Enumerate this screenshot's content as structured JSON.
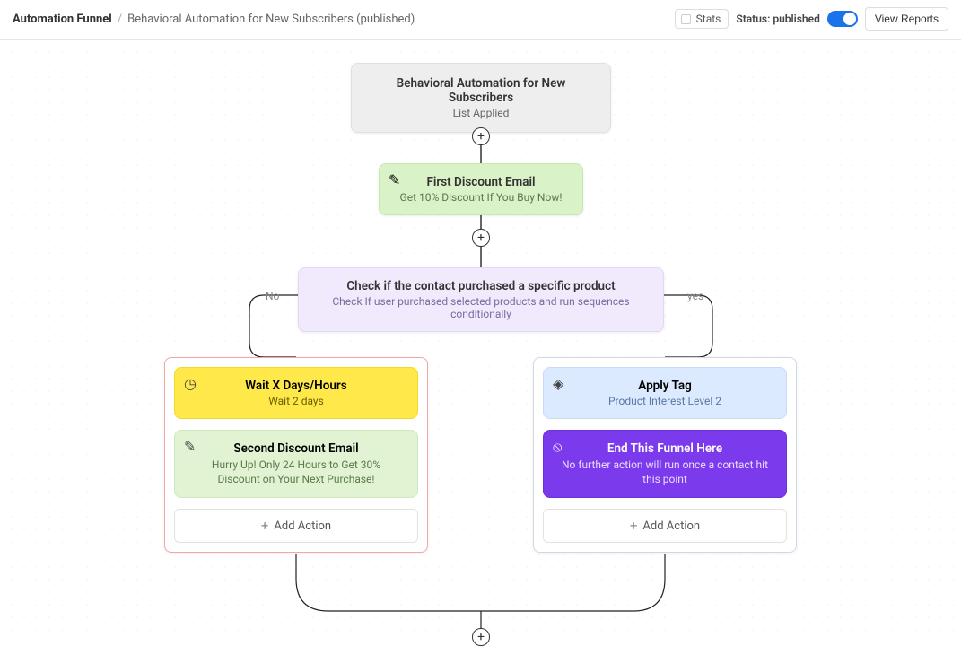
{
  "header": {
    "breadcrumb_root": "Automation Funnel",
    "breadcrumb_sep": "/",
    "breadcrumb_current": "Behavioral Automation for New Subscribers (published)",
    "stats_label": "Stats",
    "status_label": "Status: published",
    "view_reports": "View Reports"
  },
  "trigger": {
    "title": "Behavioral Automation for New Subscribers",
    "subtitle": "List Applied"
  },
  "email1": {
    "title": "First Discount Email",
    "subtitle": "Get 10% Discount If You Buy Now!"
  },
  "condition": {
    "title": "Check if the contact purchased a specific product",
    "subtitle": "Check If user purchased selected products and run sequences conditionally",
    "no_label": "No",
    "yes_label": "yes"
  },
  "no_branch": {
    "wait_title": "Wait X Days/Hours",
    "wait_subtitle": "Wait 2 days",
    "email2_title": "Second Discount Email",
    "email2_subtitle": "Hurry Up! Only 24 Hours to Get 30% Discount on Your Next Purchase!",
    "add_action": "Add Action"
  },
  "yes_branch": {
    "tag_title": "Apply Tag",
    "tag_subtitle": "Product Interest Level 2",
    "end_title": "End This Funnel Here",
    "end_subtitle": "No further action will run once a contact hit this point",
    "add_action": "Add Action"
  },
  "icons": {
    "edit": "✎",
    "clock": "◷",
    "tag": "◈",
    "stop": "⦸",
    "plus": "+"
  }
}
